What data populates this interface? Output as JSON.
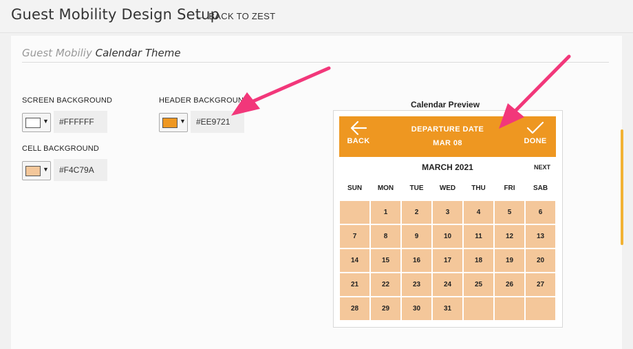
{
  "app": {
    "title": "Guest Mobility Design Setup",
    "back_label": "BACK TO ZEST"
  },
  "section": {
    "title_light": "Guest Mobiliy",
    "title_main": "Calendar Theme"
  },
  "fields": {
    "screen_background": {
      "label": "SCREEN BACKGROUND",
      "value": "#FFFFFF",
      "color": "#FFFFFF"
    },
    "header_background": {
      "label": "HEADER BACKGROUND",
      "value": "#EE9721",
      "color": "#EE9721"
    },
    "cell_background": {
      "label": "CELL BACKGROUND",
      "value": "#F4C79A",
      "color": "#F4C79A"
    }
  },
  "preview": {
    "label": "Calendar Preview",
    "back_label": "BACK",
    "done_label": "DONE",
    "header_title": "DEPARTURE DATE",
    "header_date": "MAR 08",
    "month": "MARCH 2021",
    "next_label": "NEXT",
    "weekdays": [
      "SUN",
      "MON",
      "TUE",
      "WED",
      "THU",
      "FRI",
      "SAB"
    ],
    "days": [
      "",
      "1",
      "2",
      "3",
      "4",
      "5",
      "6",
      "7",
      "8",
      "9",
      "10",
      "11",
      "12",
      "13",
      "14",
      "15",
      "16",
      "17",
      "18",
      "19",
      "20",
      "21",
      "22",
      "23",
      "24",
      "25",
      "26",
      "27",
      "28",
      "29",
      "30",
      "31",
      "",
      "",
      ""
    ]
  },
  "colors": {
    "accent": "#EE9721",
    "cell": "#F4C79A",
    "annotation_arrow": "#F2377A",
    "scroll_thumb": "#F2B233"
  },
  "icons": {
    "back": "arrow-left-icon",
    "done": "check-icon",
    "swatch_dropdown": "caret-down-icon"
  }
}
